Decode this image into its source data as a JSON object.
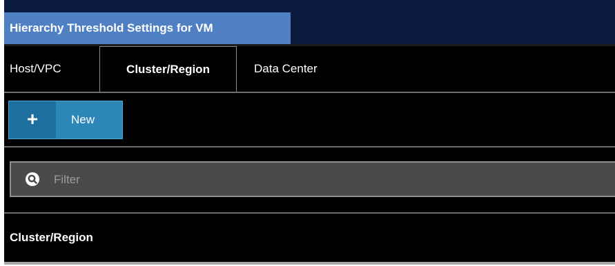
{
  "window": {
    "title": "Hierarchy Threshold Settings for VM"
  },
  "tabs": [
    {
      "label": "Host/VPC",
      "selected": false
    },
    {
      "label": "Cluster/Region",
      "selected": true
    },
    {
      "label": "Data Center",
      "selected": false
    }
  ],
  "toolbar": {
    "new_icon": "+",
    "new_label": "New"
  },
  "filter": {
    "icon": "search-icon",
    "placeholder": "Filter",
    "value": ""
  },
  "table": {
    "columns": [
      "Cluster/Region"
    ]
  },
  "colors": {
    "title_tab": "#4f80c4",
    "title_bar": "#0a1a3e",
    "new_button": "#2c87b8",
    "new_icon_bg": "#1d6f9d",
    "background": "#050505"
  }
}
